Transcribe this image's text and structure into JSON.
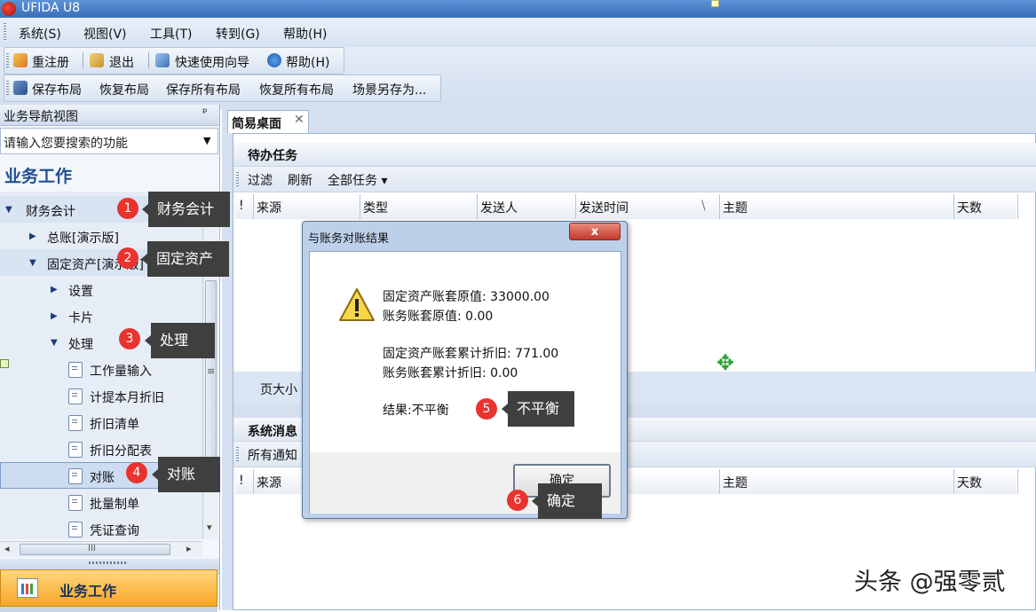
{
  "window": {
    "title": "UFIDA U8"
  },
  "menubar": {
    "items": [
      "系统(S)",
      "视图(V)",
      "工具(T)",
      "转到(G)",
      "帮助(H)"
    ]
  },
  "toolbar1": {
    "relogin": "重注册",
    "exit": "退出",
    "wizard": "快速使用向导",
    "help": "帮助(H)"
  },
  "toolbar2": {
    "items": [
      "保存布局",
      "恢复布局",
      "保存所有布局",
      "恢复所有布局",
      "场景另存为..."
    ]
  },
  "nav": {
    "header": "业务导航视图",
    "pin_glyph": "ᵖ",
    "search_placeholder": "请输入您要搜索的功能",
    "dropdown_glyph": "▼",
    "section_title": "业务工作",
    "tree": [
      "财务会计",
      "总账[演示版]",
      "固定资产[演示版]",
      "设置",
      "卡片",
      "处理",
      "工作量输入",
      "计提本月折旧",
      "折旧清单",
      "折旧分配表",
      "对账",
      "批量制单",
      "凭证查询"
    ],
    "arrow_right": "▶",
    "arrow_down": "▼",
    "hscroll_left": "◂",
    "hscroll_right": "▸",
    "hscroll_grip": "III",
    "scroll_grip": "≡",
    "scroll_down": "▾",
    "business_tab": "业务工作"
  },
  "main": {
    "tab_label": "简易桌面",
    "tab_close": "✕",
    "todo_title": "待办任务",
    "todo_toolbar": [
      "过滤",
      "刷新",
      "全部任务 ▾"
    ],
    "grid_columns": [
      "!",
      "来源",
      "类型",
      "发送人",
      "发送时间",
      "主题",
      "天数"
    ],
    "sort_glyph": "\\",
    "paging_text": "页大小",
    "sys_title": "系统消息",
    "sys_toolbar": "所有通知",
    "sys_columns": [
      "!",
      "来源",
      "",
      "",
      "间",
      "主题",
      "天数"
    ]
  },
  "dialog": {
    "title": "与账务对账结果",
    "close_glyph": "x",
    "lines": [
      "固定资产账套原值:   33000.00",
      "账务账套原值:   0.00",
      "固定资产账套累计折旧:   771.00",
      "账务账套累计折旧:   0.00",
      "结果:不平衡"
    ],
    "ok_label": "确定"
  },
  "callouts": [
    {
      "step": "1",
      "text": "财务会计"
    },
    {
      "step": "2",
      "text": "固定资产"
    },
    {
      "step": "3",
      "text": "处理"
    },
    {
      "step": "4",
      "text": "对账"
    },
    {
      "step": "5",
      "text": "不平衡"
    },
    {
      "step": "6",
      "text": "确定"
    }
  ],
  "watermark": "头条 @强零贰",
  "colors": {
    "accent": "#1e4f91",
    "callout_bg": "#3f3f3f",
    "step_badge": "#e8332e",
    "business_tab": "#f6a623"
  },
  "icons": [
    "app-logo-icon",
    "relogin-icon",
    "exit-icon",
    "wizard-icon",
    "help-icon",
    "save-layout-icon",
    "pin-icon",
    "warning-icon",
    "move-cursor-icon"
  ]
}
